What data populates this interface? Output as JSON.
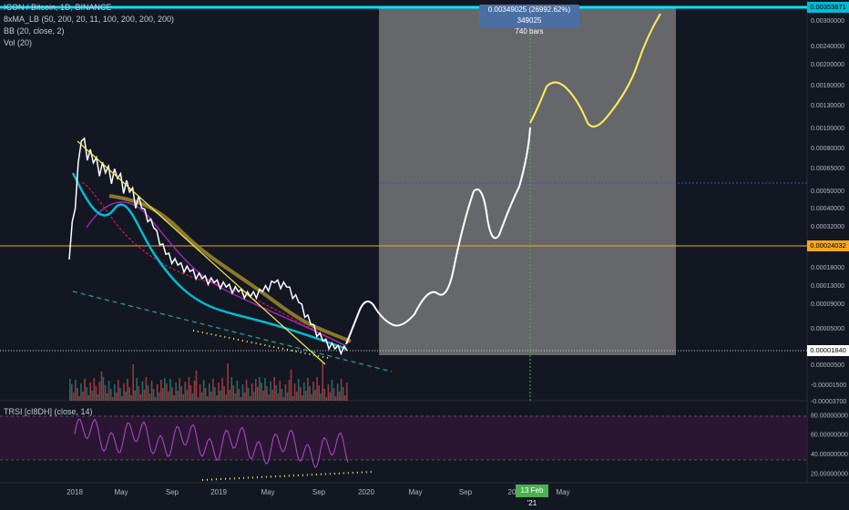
{
  "legend": {
    "symbol": "ICON / Bitcoin, 1D, BINANCE",
    "ma": "8xMA_LB (50, 200, 20, 11, 100, 200, 200, 200)",
    "bb": "BB (20, close, 2)",
    "vol": "Vol (20)"
  },
  "rsi_legend": "TRSI [cI8DH] (close, 14)",
  "measure": {
    "line1": "0.00349025 (26992.62%) 349025",
    "line2": "740 bars"
  },
  "price_tags": {
    "top": "0.00353871",
    "hline": "0.00024032",
    "last": "0.00001840"
  },
  "date_tag": "13 Feb '21",
  "colors": {
    "background": "#131722",
    "price": "#ffffff",
    "projection_yellow": "#ffee58",
    "cyan_line": "#00e5ff",
    "hline_orange": "#f5a623",
    "rsi": "#b24cc9",
    "rsi_band": "#2a1633",
    "box": "#8a8a8a",
    "tag_cyan": "#00bcd4"
  },
  "chart_data": [
    {
      "type": "line",
      "title": "ICON / Bitcoin, 1D, BINANCE",
      "xlabel": "",
      "ylabel": "",
      "x_ticks": [
        "2018",
        "May",
        "Sep",
        "2019",
        "May",
        "Sep",
        "2020",
        "May",
        "Sep",
        "20",
        "May"
      ],
      "y_ticks": [
        "0.00300000",
        "0.00240000",
        "0.00200000",
        "0.00160000",
        "0.00130000",
        "0.00100000",
        "0.00080000",
        "0.00065000",
        "0.00050000",
        "0.00040000",
        "0.00032000",
        "0.00024032",
        "0.00018000",
        "0.00013000",
        "0.00009000",
        "0.00005000",
        "0.00001840",
        "0.00000500",
        "-0.00001500",
        "-0.00003700"
      ],
      "y_scale": "log",
      "grid": false,
      "series": [
        {
          "name": "",
          "values_description_free": true,
          "x": [
            "2017-12",
            "2018-01",
            "2018-02",
            "2018-03",
            "2018-04",
            "2018-05",
            "2018-06",
            "2018-07",
            "2018-08",
            "2018-09",
            "2018-10",
            "2018-11",
            "2018-12",
            "2019-01",
            "2019-02",
            "2019-03",
            "2019-04",
            "2019-05",
            "2019-06",
            "2019-07",
            "2019-08",
            "2019-09",
            "2019-10",
            "2019-11"
          ],
          "y": [
            0.0001,
            0.0009,
            0.0006,
            0.0005,
            0.00045,
            0.00035,
            0.00026,
            0.00018,
            0.00011,
            9e-05,
            8e-05,
            7e-05,
            6.5e-05,
            6e-05,
            5.5e-05,
            5e-05,
            5.5e-05,
            6.5e-05,
            6e-05,
            4.5e-05,
            3e-05,
            2.2e-05,
            1.9e-05,
            1.84e-05
          ]
        }
      ],
      "horizontal_line": 0.00024032,
      "measure_box": {
        "x_start": "2020-01",
        "x_end": "2021-07",
        "y_low": 1.84e-05,
        "y_high": 0.00353871
      }
    },
    {
      "type": "line",
      "title": "TRSI [cI8DH] (close, 14)",
      "y_ticks": [
        "80.00000000",
        "60.00000000",
        "40.00000000",
        "20.00000000"
      ],
      "ylim": [
        10,
        85
      ]
    }
  ]
}
